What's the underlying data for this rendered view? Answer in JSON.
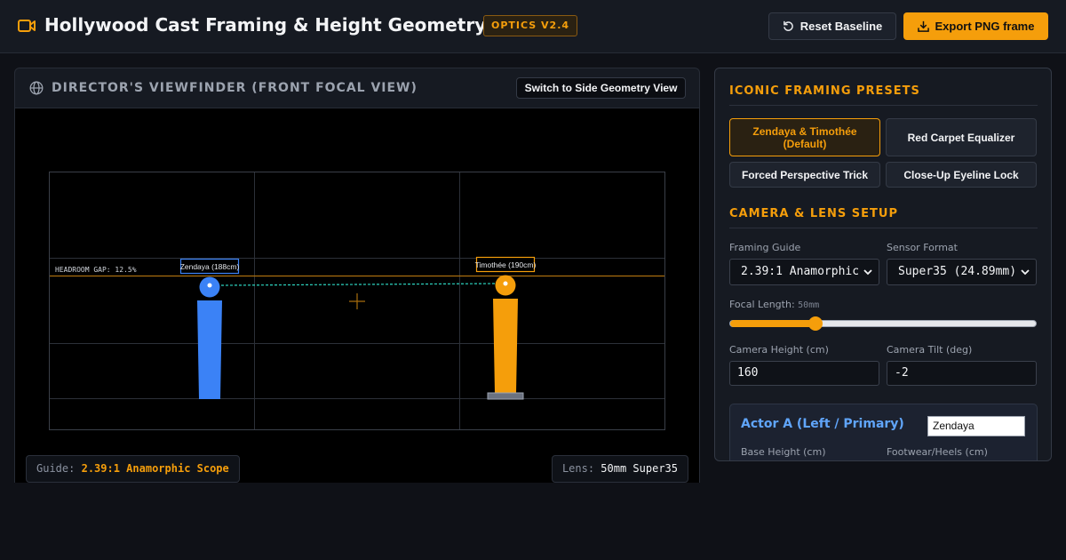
{
  "header": {
    "title": "Hollywood Cast Framing & Height Geometry Lab",
    "badge": "OPTICS V2.4",
    "reset_label": "Reset Baseline",
    "export_label": "Export PNG frame"
  },
  "viewfinder": {
    "title": "DIRECTOR'S VIEWFINDER (FRONT FOCAL VIEW)",
    "switch_label": "Switch to Side Geometry View",
    "headroom_label": "HEADROOM GAP: 12.5%",
    "actor_a_tag": "Zendaya (188cm)",
    "actor_b_tag": "Timothée (190cm)",
    "actor_a_color": "#3b82f6",
    "actor_b_color": "#f59e0b",
    "guide_key": "Guide:",
    "guide_value": "2.39:1 Anamorphic Scope",
    "lens_key": "Lens:",
    "lens_value": "50mm Super35"
  },
  "presets": {
    "title": "ICONIC FRAMING PRESETS",
    "items": [
      {
        "label": "Zendaya & Timothée (Default)",
        "active": true
      },
      {
        "label": "Red Carpet Equalizer",
        "active": false
      },
      {
        "label": "Forced Perspective Trick",
        "active": false
      },
      {
        "label": "Close-Up Eyeline Lock",
        "active": false
      }
    ]
  },
  "camera": {
    "title": "CAMERA & LENS SETUP",
    "framing_label": "Framing Guide",
    "framing_value": "2.39:1 Anamorphic",
    "sensor_label": "Sensor Format",
    "sensor_value": "Super35 (24.89mm)",
    "focal_label": "Focal Length:",
    "focal_value": "50mm",
    "focal_fraction": 0.28,
    "height_label": "Camera Height (cm)",
    "height_value": "160",
    "tilt_label": "Camera Tilt (deg)",
    "tilt_value": "-2"
  },
  "actor_a": {
    "title": "Actor A (Left / Primary)",
    "name_value": "Zendaya",
    "base_height_label": "Base Height (cm)",
    "footwear_label": "Footwear/Heels (cm)"
  }
}
